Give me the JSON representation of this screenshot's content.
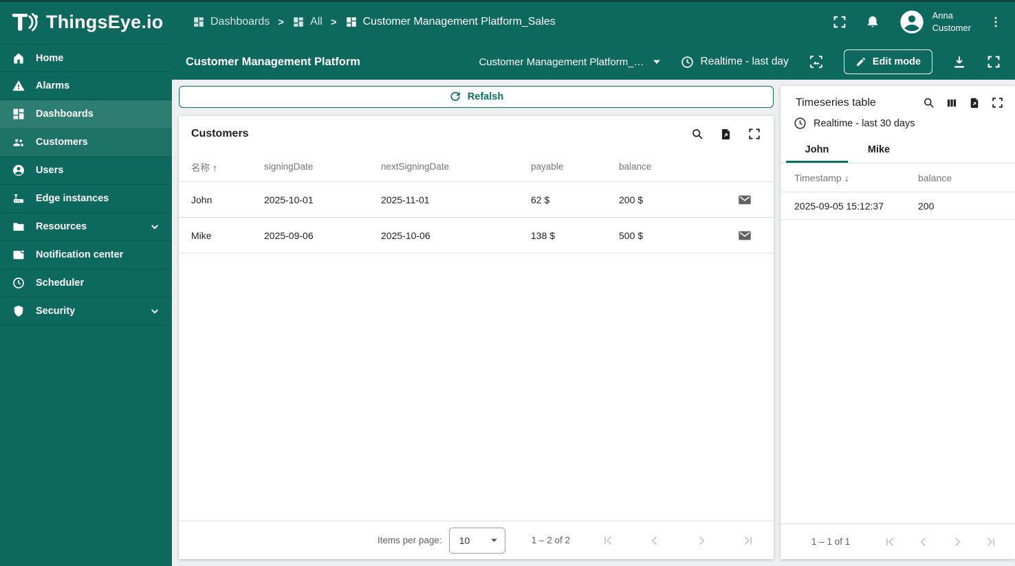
{
  "colors": {
    "teal": "#0d695d",
    "teal_active": "#2e7d71",
    "accent": "#0c6e60",
    "content_background": "#edeff0"
  },
  "brand": {
    "logo_text": "ThingsEye.io"
  },
  "topbar": {
    "separator": ">",
    "breadcrumbs": [
      {
        "label": "Dashboards"
      },
      {
        "label": "All"
      },
      {
        "label": "Customer Management Platform_Sales"
      }
    ],
    "user": {
      "name": "Anna",
      "role": "Customer"
    }
  },
  "toolbar": {
    "page_title": "Customer Management Platform",
    "dashboard_select": "Customer Management Platform_…",
    "realtime": "Realtime - last day",
    "edit_label": "Edit mode"
  },
  "sidebar": {
    "items": [
      {
        "label": "Home"
      },
      {
        "label": "Alarms"
      },
      {
        "label": "Dashboards"
      },
      {
        "label": "Customers"
      },
      {
        "label": "Users"
      },
      {
        "label": "Edge instances"
      },
      {
        "label": "Resources"
      },
      {
        "label": "Notification center"
      },
      {
        "label": "Scheduler"
      },
      {
        "label": "Security"
      }
    ]
  },
  "main": {
    "refresh_label": "Refalsh",
    "customers": {
      "title": "Customers",
      "sort_asc": "↑",
      "columns": {
        "name": "名称",
        "signing": "signingDate",
        "next": "nextSigningDate",
        "payable": "payable",
        "balance": "balance"
      },
      "rows": [
        {
          "name": "John",
          "signing": "2025-10-01",
          "next": "2025-11-01",
          "payable": "62 $",
          "balance": "200 $"
        },
        {
          "name": "Mike",
          "signing": "2025-09-06",
          "next": "2025-10-06",
          "payable": "138 $",
          "balance": "500 $"
        }
      ],
      "pagination": {
        "items_per_page_label": "Items per page:",
        "page_size": "10",
        "range": "1 – 2 of 2"
      }
    }
  },
  "timeseries": {
    "title": "Timeseries table",
    "realtime": "Realtime - last 30 days",
    "sort_desc": "↓",
    "tabs": [
      {
        "label": "John"
      },
      {
        "label": "Mike"
      }
    ],
    "columns": {
      "timestamp": "Timestamp",
      "balance": "balance"
    },
    "rows": [
      {
        "timestamp": "2025-09-05 15:12:37",
        "balance": "200"
      }
    ],
    "pagination": {
      "range": "1 – 1 of 1"
    }
  }
}
